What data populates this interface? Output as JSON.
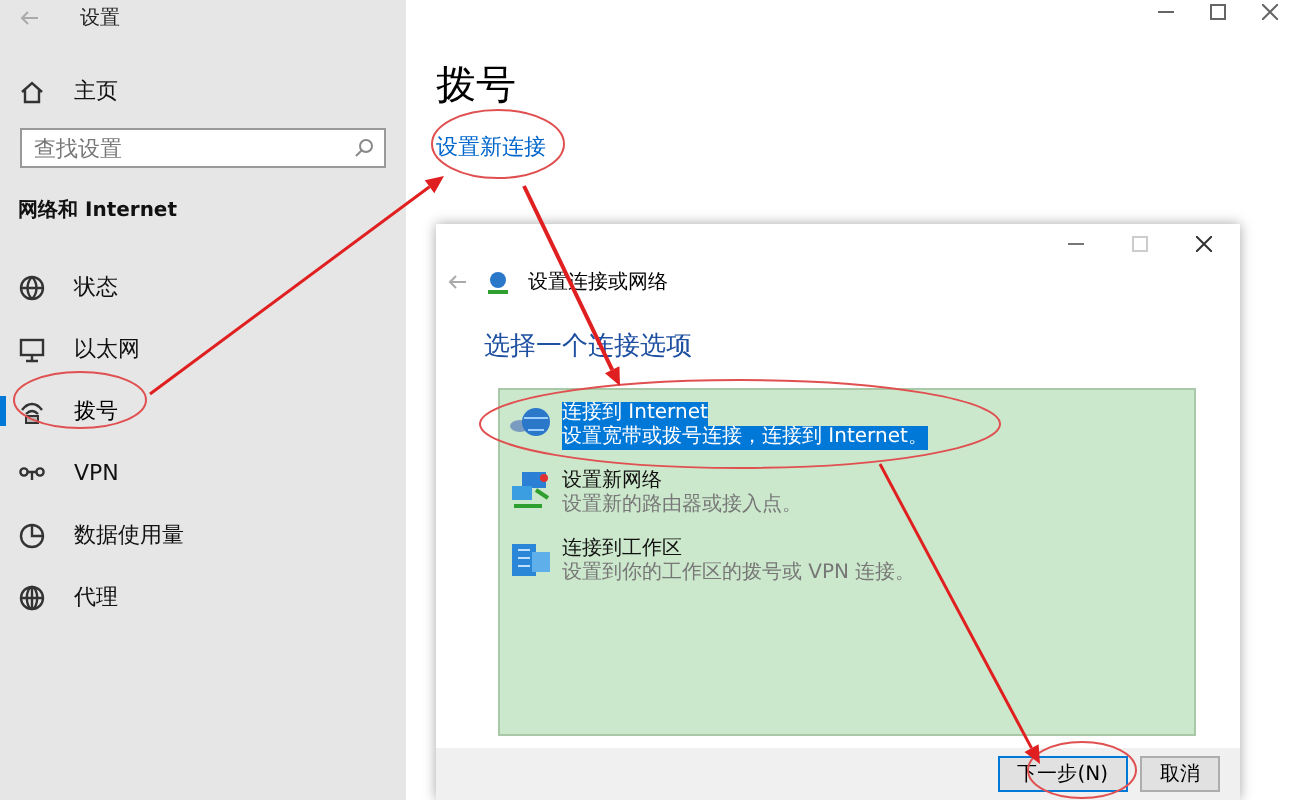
{
  "window": {
    "title": "设置"
  },
  "sidebar": {
    "home": {
      "label": "主页"
    },
    "search": {
      "placeholder": "查找设置"
    },
    "section": "网络和 Internet",
    "items": [
      {
        "label": "状态",
        "kind": "status",
        "selected": false
      },
      {
        "label": "以太网",
        "kind": "ethernet",
        "selected": false
      },
      {
        "label": "拨号",
        "kind": "dialup",
        "selected": true
      },
      {
        "label": "VPN",
        "kind": "vpn",
        "selected": false
      },
      {
        "label": "数据使用量",
        "kind": "data",
        "selected": false
      },
      {
        "label": "代理",
        "kind": "proxy",
        "selected": false
      }
    ]
  },
  "main": {
    "title": "拨号",
    "link": "设置新连接"
  },
  "dialog": {
    "title": "设置连接或网络",
    "heading": "选择一个连接选项",
    "options": [
      {
        "kind": "internet",
        "title": "连接到 Internet",
        "description": "设置宽带或拨号连接，连接到 Internet。",
        "selected": true
      },
      {
        "kind": "network",
        "title": "设置新网络",
        "description": "设置新的路由器或接入点。",
        "selected": false
      },
      {
        "kind": "workplace",
        "title": "连接到工作区",
        "description": "设置到你的工作区的拨号或 VPN 连接。",
        "selected": false
      }
    ],
    "buttons": [
      {
        "label": "下一步(N)",
        "default": true
      },
      {
        "label": "取消",
        "default": false
      }
    ]
  }
}
